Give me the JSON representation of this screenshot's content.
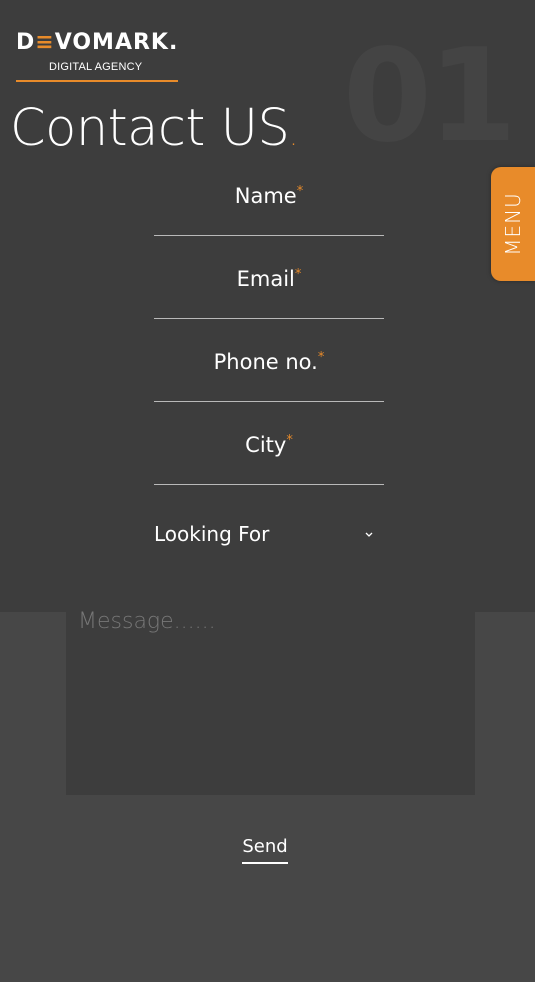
{
  "brand": {
    "logo_pre": "D",
    "logo_accent": "≡",
    "logo_post": "VOMARK.",
    "tagline": "DIGITAL AGENCY",
    "accent_color": "#e88b2a"
  },
  "hero": {
    "title": "Contact US",
    "title_dot": ".",
    "background_number": "01"
  },
  "menu": {
    "label": "MENU"
  },
  "form": {
    "fields": [
      {
        "label": "Name",
        "required_marker": "*"
      },
      {
        "label": "Email",
        "required_marker": "*"
      },
      {
        "label": "Phone no.",
        "required_marker": "*"
      },
      {
        "label": "City",
        "required_marker": "*"
      }
    ],
    "looking_for": {
      "label": "Looking For",
      "chevron_icon": "chevron-down-icon"
    },
    "message_placeholder": "Message......",
    "send_label": "Send"
  }
}
